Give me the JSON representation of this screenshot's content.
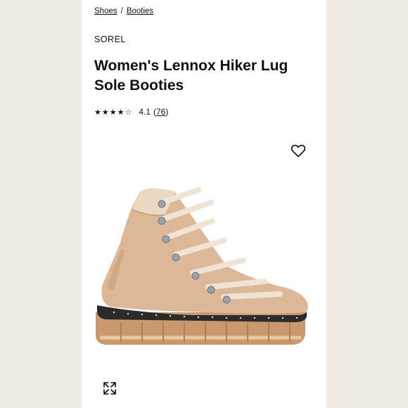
{
  "breadcrumb": {
    "items": [
      "Shoes",
      "Booties"
    ],
    "separator": "/"
  },
  "product": {
    "brand": "SOREL",
    "title": "Women's Lennox Hiker Lug Sole Booties",
    "rating": {
      "stars": "★★★★☆",
      "value": "4.1",
      "count": "76",
      "score": 4.1,
      "max": 5
    }
  },
  "icons": {
    "wishlist": "heart-icon",
    "expand": "expand-icon"
  },
  "colors": {
    "background": "#f1ebe6",
    "boot": "#dcb896",
    "laces": "#efe3d6",
    "sole": "#c9986c"
  }
}
